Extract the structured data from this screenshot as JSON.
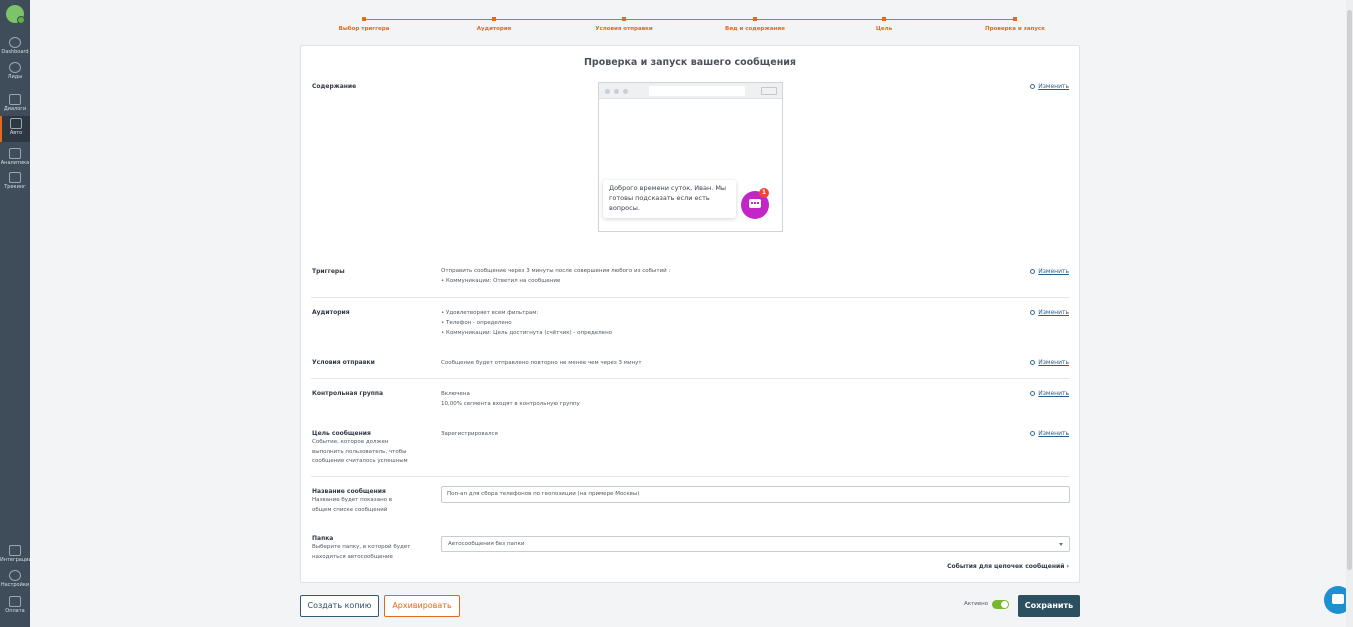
{
  "sidebar": {
    "items": [
      {
        "label": "Dashboard",
        "icon": "dashboard-icon"
      },
      {
        "label": "Лиды",
        "icon": "users-icon"
      },
      {
        "label": "Диалоги",
        "icon": "dialogs-icon"
      },
      {
        "label": "Авто",
        "icon": "auto-messages-icon"
      },
      {
        "label": "Аналитика",
        "icon": "analytics-icon"
      },
      {
        "label": "Трекинг",
        "icon": "tracking-icon"
      },
      {
        "label": "Интеграции",
        "icon": "integrations-icon"
      },
      {
        "label": "Настройки",
        "icon": "settings-icon"
      },
      {
        "label": "Оплата",
        "icon": "payment-icon"
      }
    ]
  },
  "stepper": {
    "steps": [
      "Выбор триггера",
      "Аудитория",
      "Условия отправки",
      "Вид и содержание",
      "Цель",
      "Проверка и запуск"
    ]
  },
  "card": {
    "title": "Проверка и запуск вашего сообщения",
    "edit_label": "Изменить",
    "content": {
      "label": "Содержание",
      "preview_message": "Доброго времени суток, Иван. Мы готовы подсказать если есть вопросы.",
      "preview_badge": "1"
    },
    "triggers": {
      "label": "Триггеры",
      "line1": "Отправить сообщение через 3 минуты после совершения любого из событий :",
      "line2": "• Коммуникации: Ответил на сообщение"
    },
    "audience": {
      "label": "Аудитория",
      "line1": "• Удовлетворяет всем фильтрам:",
      "line2": "• Телефон - определено",
      "line3": "• Коммуникации: Цель достигнута (счётчик) - определено"
    },
    "conditions": {
      "label": "Условия отправки",
      "value": "Сообщение будет отправлено повторно не менее чем через 3 минут"
    },
    "control_group": {
      "label": "Контрольная группа",
      "line1": "Включена",
      "line2": "10,00% сегмента входят в контрольную группу"
    },
    "goal": {
      "label": "Цель сообщения",
      "sub": "Событие, которое должен выполнить пользователь, чтобы сообщение считалось успешным",
      "value": "Зарегистрировался"
    },
    "name": {
      "label": "Название сообщения",
      "sub": "Название будет показано в общем списке сообщений",
      "value": "Поп-ап для сбора телефонов по геопозиции (на примере Москвы)"
    },
    "folder": {
      "label": "Папка",
      "sub": "Выберите папку, в которой будет находиться автосообщение",
      "selected": "Автосообщения без папки"
    },
    "chain_link": "События для цепочек сообщений ›"
  },
  "footer": {
    "copy_label": "Создать копию",
    "archive_label": "Архивировать",
    "active_label": "Активно",
    "active": true,
    "save_label": "Сохранить"
  },
  "colors": {
    "accent": "#e36a1a",
    "sidebar": "#3f4d5a",
    "save": "#2d5060",
    "toggle_on": "#77b82f",
    "chat_bubble": "#c326c6",
    "support": "#1e8fd1"
  }
}
